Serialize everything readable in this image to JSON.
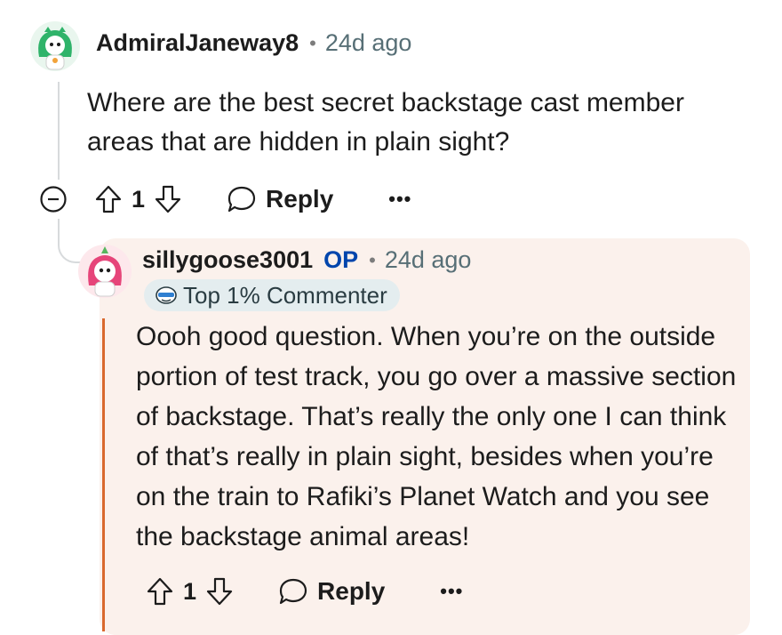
{
  "comment": {
    "username": "AdmiralJaneway8",
    "time": "24d ago",
    "text": "Where are the best secret backstage cast member areas that are hidden in plain sight?",
    "upvotes": "1",
    "reply_label": "Reply",
    "more_label": "•••",
    "collapse_icon": "minus-circle-icon"
  },
  "reply": {
    "username": "sillygoose3001",
    "op_tag": "OP",
    "time": "24d ago",
    "flair": "Top 1% Commenter",
    "text": "Oooh good question. When you’re on the outside portion of test track, you go over a massive section of backstage. That’s really the only one I can think of that’s really in plain sight, besides when you’re on the train to Rafiki’s Planet Watch and you see the backstage animal areas!",
    "upvotes": "1",
    "reply_label": "Reply",
    "more_label": "•••"
  },
  "colors": {
    "op": "#0045ac",
    "reply_background": "#fbf1ec",
    "accent_line": "#d9692e",
    "flair_background": "#e4edef"
  }
}
